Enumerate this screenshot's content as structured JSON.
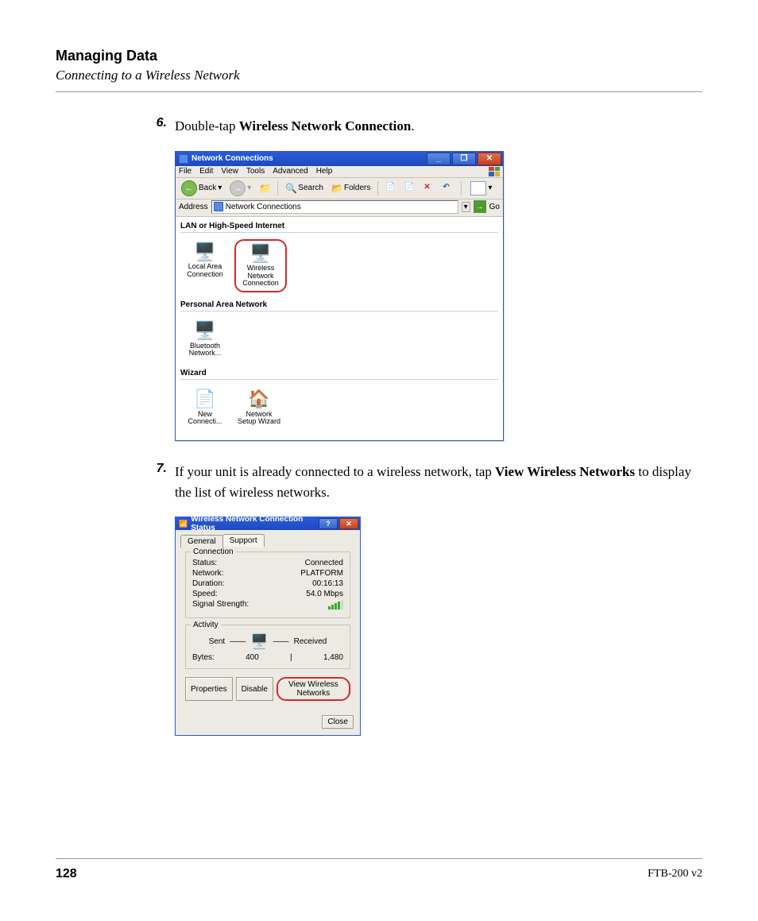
{
  "header": {
    "chapter": "Managing Data",
    "section": "Connecting to a Wireless Network"
  },
  "steps": {
    "s6": {
      "num": "6.",
      "pre": "Double-tap ",
      "bold": "Wireless Network Connection",
      "post": "."
    },
    "s7": {
      "num": "7.",
      "pre": "If your unit is already connected to a wireless network, tap ",
      "bold1": "View Wireless Networks",
      "post": " to display the list of wireless networks."
    }
  },
  "netwin": {
    "title": "Network Connections",
    "menu": [
      "File",
      "Edit",
      "View",
      "Tools",
      "Advanced",
      "Help"
    ],
    "back": "Back",
    "search": "Search",
    "folders": "Folders",
    "addr_label": "Address",
    "addr_value": "Network Connections",
    "go": "Go",
    "cats": {
      "lan": "LAN or High-Speed Internet",
      "pan": "Personal Area Network",
      "wiz": "Wizard"
    },
    "items": {
      "lan": "Local Area Connection",
      "wlan": "Wireless Network Connection",
      "bt": "Bluetooth Network...",
      "newc": "New Connecti...",
      "nsw": "Network Setup Wizard"
    }
  },
  "status": {
    "title": "Wireless Network Connection Status",
    "tabs": {
      "general": "General",
      "support": "Support"
    },
    "conn_legend": "Connection",
    "fields": {
      "status_l": "Status:",
      "status_v": "Connected",
      "network_l": "Network:",
      "network_v": "PLATFORM",
      "duration_l": "Duration:",
      "duration_v": "00:16:13",
      "speed_l": "Speed:",
      "speed_v": "54.0 Mbps",
      "signal_l": "Signal Strength:"
    },
    "activity_legend": "Activity",
    "sent": "Sent",
    "received": "Received",
    "bytes_l": "Bytes:",
    "bytes_sent": "400",
    "bytes_recv": "1,480",
    "btn_props": "Properties",
    "btn_disable": "Disable",
    "btn_view": "View Wireless Networks",
    "btn_close": "Close"
  },
  "footer": {
    "page": "128",
    "model": "FTB-200 v2"
  }
}
